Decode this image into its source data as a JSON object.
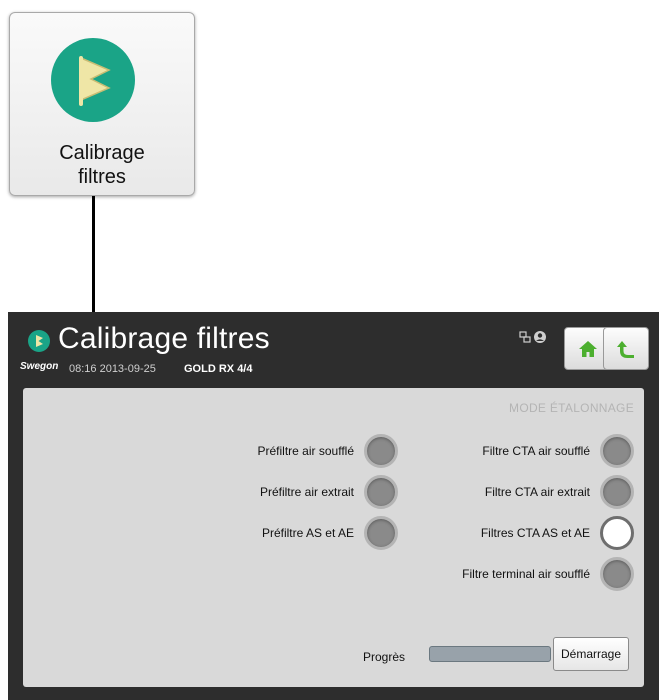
{
  "tile": {
    "label_line1": "Calibrage",
    "label_line2": "filtres",
    "icon": "filter-flag-icon",
    "color": "#1aa487"
  },
  "header": {
    "title": "Calibrage filtres",
    "brand": "Swegon",
    "datetime": "08:16 2013-09-25",
    "model": "GOLD RX",
    "page": "4/4"
  },
  "nav": {
    "home_icon": "home-icon",
    "back_icon": "back-arrow-icon",
    "icon_color": "#4caf2f"
  },
  "panel": {
    "mode_label": "MODE ÉTALONNAGE",
    "left_filters": [
      {
        "label": "Préfiltre air soufflé",
        "active": false
      },
      {
        "label": "Préfiltre air extrait",
        "active": false
      },
      {
        "label": "Préfiltre AS et AE",
        "active": false
      }
    ],
    "right_filters": [
      {
        "label": "Filtre CTA air soufflé",
        "active": false
      },
      {
        "label": "Filtre CTA air extrait",
        "active": false
      },
      {
        "label": "Filtres CTA AS et AE",
        "active": true
      },
      {
        "label": "Filtre terminal air soufflé",
        "active": false
      }
    ],
    "progress_label": "Progrès",
    "progress_fraction": 0,
    "start_label": "Démarrage"
  }
}
